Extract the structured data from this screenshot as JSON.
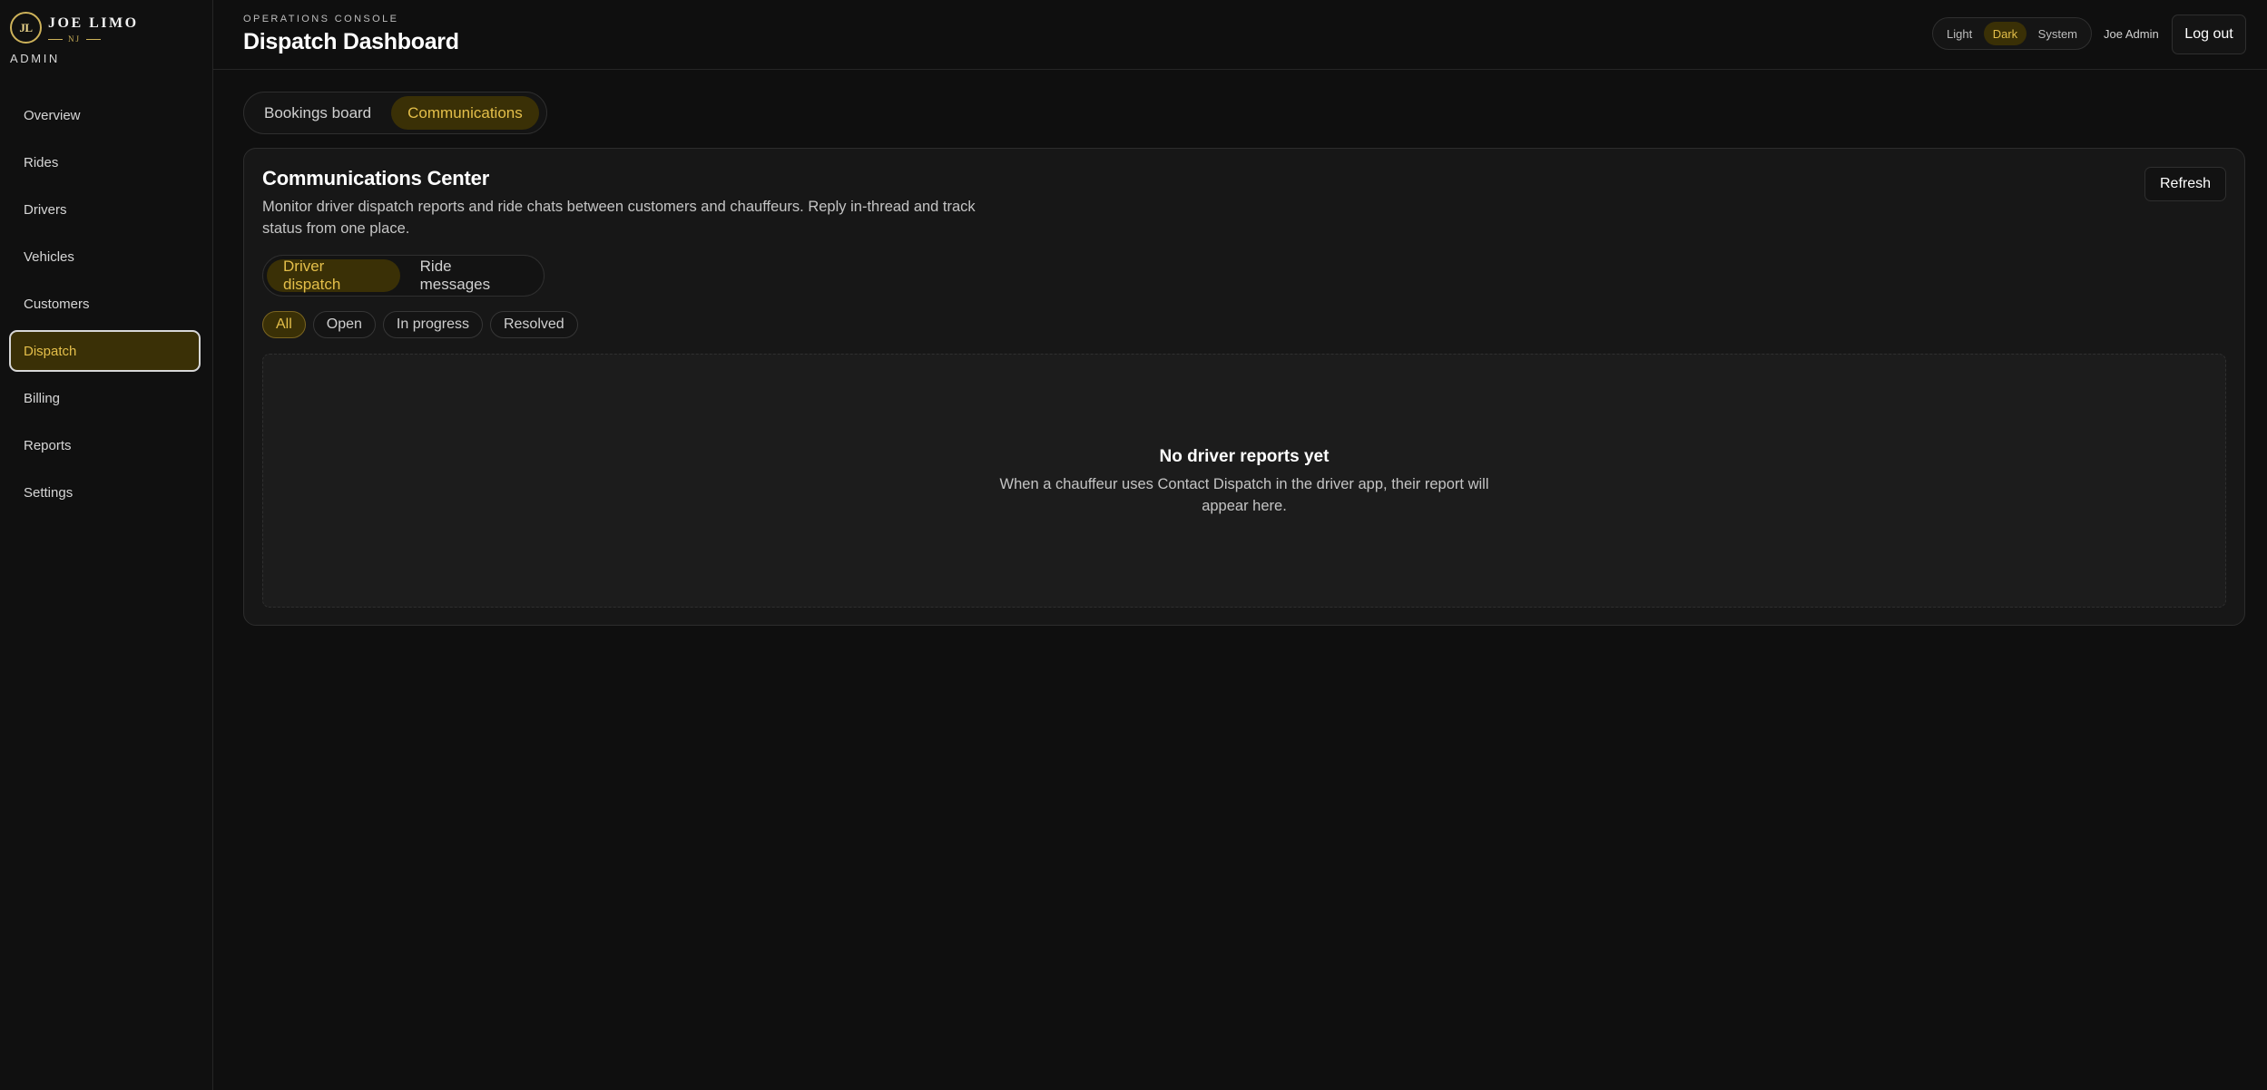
{
  "brand": {
    "mark": "JL",
    "name": "JOE LIMO",
    "sub": "NJ",
    "role": "ADMIN"
  },
  "sidebar": {
    "items": [
      {
        "label": "Overview"
      },
      {
        "label": "Rides"
      },
      {
        "label": "Drivers"
      },
      {
        "label": "Vehicles"
      },
      {
        "label": "Customers"
      },
      {
        "label": "Dispatch",
        "active": true
      },
      {
        "label": "Billing"
      },
      {
        "label": "Reports"
      },
      {
        "label": "Settings"
      }
    ]
  },
  "header": {
    "eyebrow": "OPERATIONS CONSOLE",
    "title": "Dispatch Dashboard",
    "theme": {
      "options": [
        "Light",
        "Dark",
        "System"
      ],
      "selected": "Dark"
    },
    "user": "Joe Admin",
    "logout_label": "Log out"
  },
  "main": {
    "tabs": [
      {
        "label": "Bookings board"
      },
      {
        "label": "Communications",
        "active": true
      }
    ],
    "panel": {
      "title": "Communications Center",
      "description": "Monitor driver dispatch reports and ride chats between customers and chauffeurs. Reply in-thread and track status from one place.",
      "refresh_label": "Refresh",
      "subtabs": [
        {
          "label": "Driver dispatch",
          "active": true
        },
        {
          "label": "Ride messages"
        }
      ],
      "filters": [
        {
          "label": "All",
          "active": true
        },
        {
          "label": "Open"
        },
        {
          "label": "In progress"
        },
        {
          "label": "Resolved"
        }
      ],
      "empty": {
        "title": "No driver reports yet",
        "text": "When a chauffeur uses Contact Dispatch in the driver app, their report will appear here."
      }
    }
  },
  "colors": {
    "accent": "#e4bf4a",
    "accent_bg": "#3a3006",
    "background": "#0f0f0f",
    "panel": "#171717"
  }
}
